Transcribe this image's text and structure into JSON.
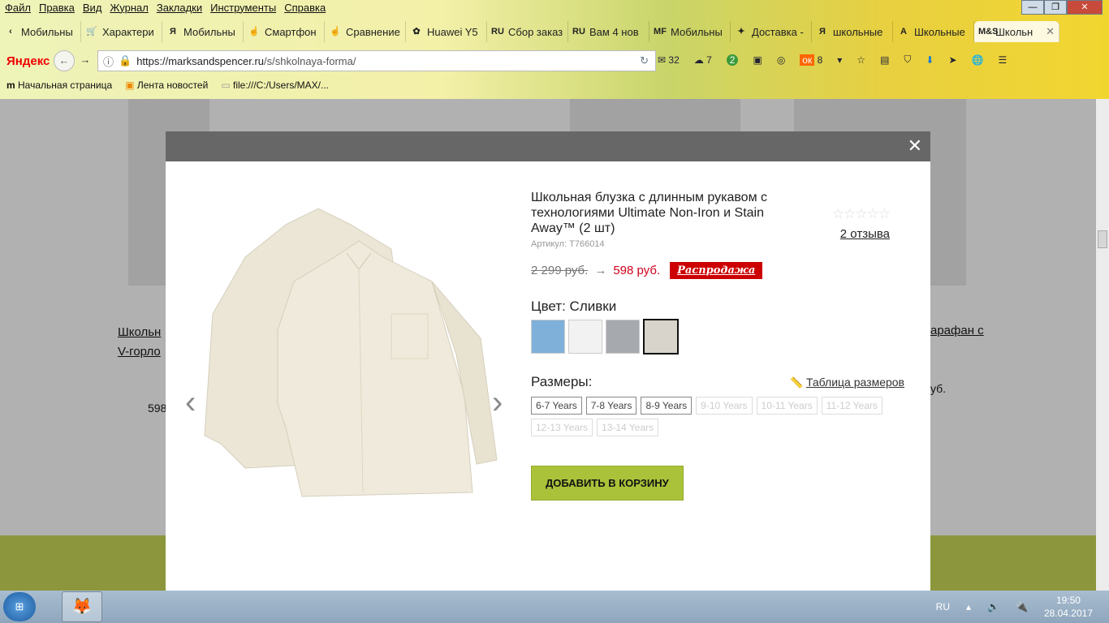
{
  "browser": {
    "menu": [
      "Файл",
      "Правка",
      "Вид",
      "Журнал",
      "Закладки",
      "Инструменты",
      "Справка"
    ],
    "tabs": [
      {
        "label": "Мобильны",
        "icon": "‹"
      },
      {
        "label": "Характери",
        "icon": "🛒"
      },
      {
        "label": "Мобильны",
        "icon": "Я"
      },
      {
        "label": "Смартфон",
        "icon": "☝"
      },
      {
        "label": "Сравнение",
        "icon": "☝"
      },
      {
        "label": "Huawei Y5",
        "icon": "✿"
      },
      {
        "label": "Сбор заказ",
        "icon": "RU"
      },
      {
        "label": "Вам 4 нов",
        "icon": "RU"
      },
      {
        "label": "Мобильны",
        "icon": "MF"
      },
      {
        "label": "Доставка -",
        "icon": "✦"
      },
      {
        "label": "школьные",
        "icon": "Я"
      },
      {
        "label": "Школьные",
        "icon": "A"
      },
      {
        "label": "Школьн",
        "icon": "M&S",
        "active": true
      }
    ],
    "logo": "Яндекс",
    "url_host": "https://marksandspencer.ru",
    "url_path": "/s/shkolnaya-forma/",
    "toolbar_counts": {
      "mail": "32",
      "cloud": "7",
      "green": "2",
      "ok": "8"
    },
    "bookmarks": [
      "Начальная страница",
      "Лента новостей",
      "file:///C:/Users/MAX/..."
    ]
  },
  "background": {
    "left_link_line1": "Школьн",
    "left_link_line2": "V-горло",
    "left_price": "598",
    "right_link": "арафан с",
    "right_price": "уб."
  },
  "product": {
    "title": "Школьная блузка с длинным рукавом с технологиями Ultimate Non-Iron и Stain Away™ (2 шт)",
    "sku": "Артикул: T766014",
    "stars": "☆☆☆☆☆",
    "rating": 0,
    "reviews": "2 отзыва",
    "old_price": "2 299 руб.",
    "arrow": "→",
    "new_price": "598 руб.",
    "sale_badge": "Распродажа",
    "color_label": "Цвет: Сливки",
    "colors": [
      "#7fb0da",
      "#f2f2f2",
      "#a6a9ad",
      "#d8d4cc"
    ],
    "sizes_label": "Размеры:",
    "size_chart": "Таблица размеров",
    "sizes": [
      {
        "label": "6-7 Years",
        "available": true
      },
      {
        "label": "7-8 Years",
        "available": true
      },
      {
        "label": "8-9 Years",
        "available": true
      },
      {
        "label": "9-10 Years",
        "available": false
      },
      {
        "label": "10-11 Years",
        "available": false
      },
      {
        "label": "11-12 Years",
        "available": false
      },
      {
        "label": "12-13 Years",
        "available": false
      },
      {
        "label": "13-14 Years",
        "available": false
      }
    ],
    "add_to_cart": "ДОБАВИТЬ В КОРЗИНУ"
  },
  "taskbar": {
    "lang": "RU",
    "time": "19:50",
    "date": "28.04.2017"
  }
}
